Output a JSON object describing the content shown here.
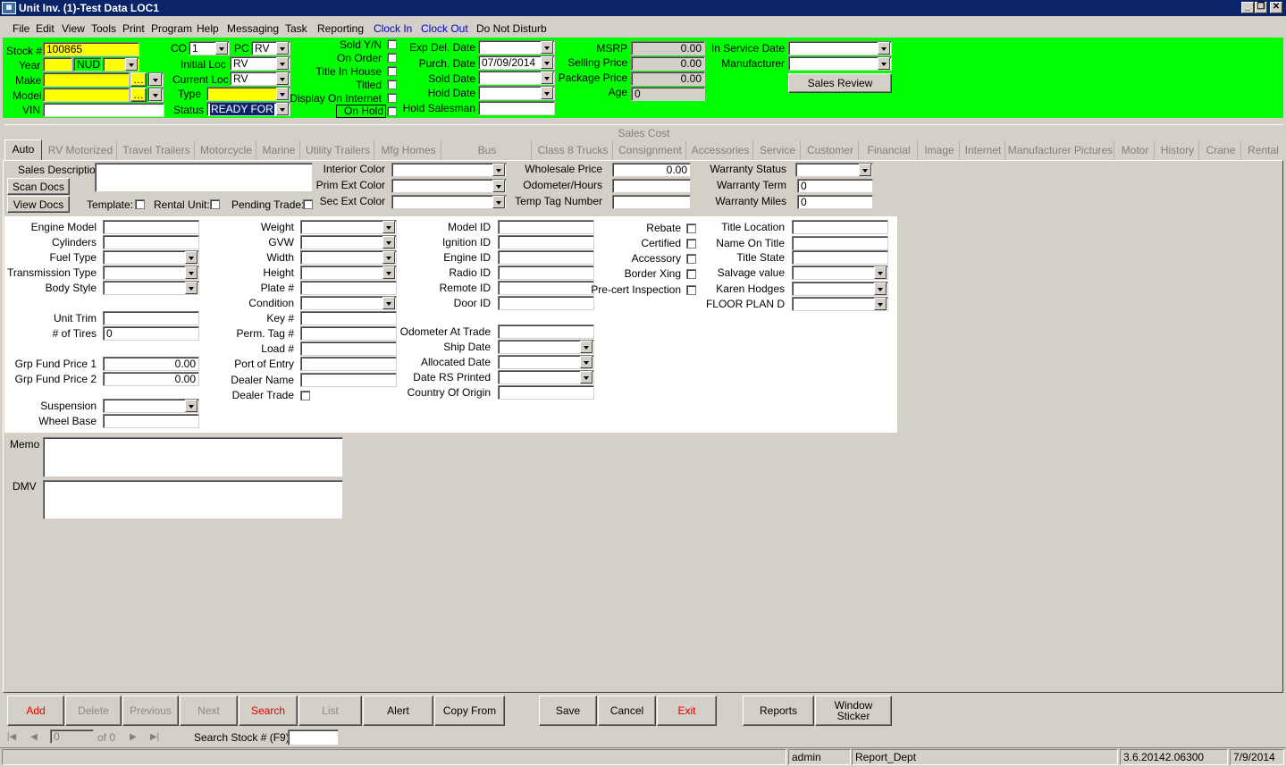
{
  "window": {
    "title": "Unit Inv. (1)-Test Data LOC1",
    "icon": "app-icon",
    "controls": [
      "minimize",
      "restore",
      "close"
    ]
  },
  "menu": [
    {
      "label": "File",
      "color": "#000"
    },
    {
      "label": "Edit",
      "color": "#000"
    },
    {
      "label": "View",
      "color": "#000"
    },
    {
      "label": "Tools",
      "color": "#000"
    },
    {
      "label": "Print",
      "color": "#000"
    },
    {
      "label": "Program",
      "color": "#000"
    },
    {
      "label": "Help",
      "color": "#000"
    },
    {
      "label": "Messaging",
      "color": "#000"
    },
    {
      "label": "Task",
      "color": "#000"
    },
    {
      "label": "Reporting",
      "color": "#000"
    },
    {
      "label": "Clock In",
      "color": "#0000cc"
    },
    {
      "label": "Clock Out",
      "color": "#0000cc"
    },
    {
      "label": "Do Not Disturb",
      "color": "#000"
    }
  ],
  "header": {
    "stock_label": "Stock #",
    "stock_value": "100865",
    "year_label": "Year",
    "year_value": "",
    "nud_value": "NUD",
    "nud2_value": "",
    "make_label": "Make",
    "make_value": "",
    "model_label": "Model",
    "model_value": "",
    "vin_label": "VIN",
    "vin_value": "",
    "co_label": "CO",
    "co_value": "1",
    "pc_label": "PC",
    "pc_value": "RV",
    "initial_loc_label": "Initial Loc",
    "initial_loc_value": "RV",
    "current_loc_label": "Current Loc",
    "current_loc_value": "RV",
    "type_label": "Type",
    "type_value": "",
    "status_label": "Status",
    "status_value": "READY FOR",
    "sold_yn_label": "Sold Y/N",
    "on_order_label": "On Order",
    "title_in_house_label": "Title In House",
    "titled_label": "Titled",
    "display_internet_label": "Display On Internet",
    "on_hold_label": "On Hold",
    "exp_del_label": "Exp Del. Date",
    "exp_del_value": "",
    "purch_label": "Purch. Date",
    "purch_value": "07/09/2014",
    "sold_date_label": "Sold Date",
    "sold_date_value": "",
    "hold_date_label": "Hold Date",
    "hold_date_value": "",
    "hold_salesman_label": "Hold Salesman",
    "hold_salesman_value": "",
    "msrp_label": "MSRP",
    "msrp_value": "0.00",
    "selling_label": "Selling Price",
    "selling_value": "0.00",
    "package_label": "Package Price",
    "package_value": "0.00",
    "age_label": "Age",
    "age_value": "0",
    "in_service_label": "In Service Date",
    "in_service_value": "",
    "manufacturer_label": "Manufacturer",
    "manufacturer_value": "",
    "sales_review_label": "Sales Review"
  },
  "sales_cost_label": "Sales Cost",
  "tabs": [
    "Auto",
    "RV Motorized",
    "Travel Trailers",
    "Motorcycle",
    "Marine",
    "Utility Trailers",
    "Mfg Homes",
    "Bus",
    "Class 8 Trucks",
    "Consignment",
    "Accessories",
    "Service",
    "Customer",
    "Financial",
    "Image",
    "Internet",
    "Manufacturer Pictures",
    "Motor",
    "History",
    "Crane",
    "Rental"
  ],
  "sales_section": {
    "sales_desc_label": "Sales Description",
    "scan_docs_label": "Scan Docs",
    "view_docs_label": "View Docs",
    "template_label": "Template:",
    "rental_unit_label": "Rental Unit:",
    "pending_trade_label": "Pending Trade:",
    "interior_color_label": "Interior Color",
    "prim_ext_label": "Prim Ext Color",
    "sec_ext_label": "Sec Ext Color",
    "wholesale_label": "Wholesale Price",
    "wholesale_value": "0.00",
    "odometer_label": "Odometer/Hours",
    "odometer_value": "",
    "temp_tag_label": "Temp Tag Number",
    "temp_tag_value": "",
    "warranty_status_label": "Warranty Status",
    "warranty_term_label": "Warranty Term",
    "warranty_term_value": "0",
    "warranty_miles_label": "Warranty Miles",
    "warranty_miles_value": "0"
  },
  "auto": {
    "col1": [
      {
        "label": "Engine Model",
        "type": "text",
        "value": ""
      },
      {
        "label": "Cylinders",
        "type": "text",
        "value": ""
      },
      {
        "label": "Fuel Type",
        "type": "dd",
        "value": ""
      },
      {
        "label": "Transmission Type",
        "type": "dd",
        "value": ""
      },
      {
        "label": "Body Style",
        "type": "dd",
        "value": ""
      },
      {
        "label": "Unit Trim",
        "type": "text",
        "value": ""
      },
      {
        "label": "# of Tires",
        "type": "text",
        "value": "0"
      },
      {
        "label": "Grp Fund Price 1",
        "type": "num",
        "value": "0.00"
      },
      {
        "label": "Grp Fund Price 2",
        "type": "num",
        "value": "0.00"
      },
      {
        "label": "Suspension",
        "type": "dd",
        "value": ""
      },
      {
        "label": "Wheel Base",
        "type": "text",
        "value": ""
      }
    ],
    "col2": [
      {
        "label": "Weight",
        "type": "dd"
      },
      {
        "label": "GVW",
        "type": "dd"
      },
      {
        "label": "Width",
        "type": "dd"
      },
      {
        "label": "Height",
        "type": "dd"
      },
      {
        "label": "Plate #",
        "type": "text"
      },
      {
        "label": "Condition",
        "type": "dd"
      },
      {
        "label": "Key #",
        "type": "text"
      },
      {
        "label": "Perm. Tag #",
        "type": "text"
      },
      {
        "label": "Load #",
        "type": "text"
      },
      {
        "label": "Port of Entry",
        "type": "text"
      },
      {
        "label": "Dealer Name",
        "type": "text"
      },
      {
        "label": "Dealer Trade",
        "type": "cb"
      }
    ],
    "col3": [
      {
        "label": "Model ID",
        "type": "text"
      },
      {
        "label": "Ignition ID",
        "type": "text"
      },
      {
        "label": "Engine ID",
        "type": "text"
      },
      {
        "label": "Radio ID",
        "type": "text"
      },
      {
        "label": "Remote ID",
        "type": "text"
      },
      {
        "label": "Door ID",
        "type": "text"
      },
      {
        "label": "Odometer At Trade",
        "type": "text"
      },
      {
        "label": "Ship Date",
        "type": "dd"
      },
      {
        "label": "Allocated Date",
        "type": "dd"
      },
      {
        "label": "Date RS Printed",
        "type": "dd"
      },
      {
        "label": "Country Of Origin",
        "type": "text"
      }
    ],
    "col4": [
      {
        "label": "Rebate"
      },
      {
        "label": "Certified"
      },
      {
        "label": "Accessory"
      },
      {
        "label": "Border Xing"
      },
      {
        "label": "Pre-cert Inspection"
      }
    ],
    "col5": [
      {
        "label": "Title Location",
        "type": "text"
      },
      {
        "label": "Name On Title",
        "type": "text"
      },
      {
        "label": "Title State",
        "type": "text"
      },
      {
        "label": "Salvage value",
        "type": "dd"
      },
      {
        "label": "Karen Hodges",
        "type": "dd"
      },
      {
        "label": "FLOOR PLAN D",
        "type": "dd"
      }
    ]
  },
  "memo_label": "Memo",
  "dmv_label": "DMV",
  "buttons": {
    "add": "Add",
    "delete": "Delete",
    "previous": "Previous",
    "next": "Next",
    "search": "Search",
    "list": "List",
    "alert": "Alert",
    "copy_from": "Copy From",
    "save": "Save",
    "cancel": "Cancel",
    "exit": "Exit",
    "reports": "Reports",
    "window_sticker": "Window Sticker"
  },
  "record_nav": {
    "position": "0",
    "of_label": "of 0",
    "search_stock_label": "Search Stock # (F9):",
    "search_stock_value": ""
  },
  "status": {
    "user": "admin",
    "dept": "Report_Dept",
    "version": "3.6.20142.06300",
    "date": "7/9/2014"
  }
}
